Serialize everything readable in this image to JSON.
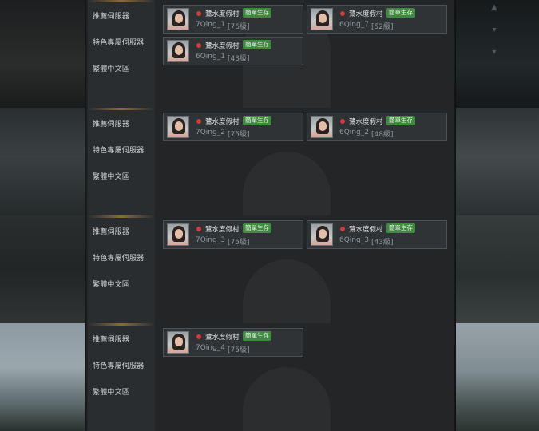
{
  "sidebar": {
    "categories": [
      "推薦伺服器",
      "特色專屬伺服器",
      "繁體中文區"
    ]
  },
  "panels": [
    {
      "cards": [
        {
          "server": "鷺水度假村",
          "badge": "簡單生存",
          "character": "7Qing_1",
          "level": "[76級]"
        },
        {
          "server": "鷺水度假村",
          "badge": "簡單生存",
          "character": "6Qing_7",
          "level": "[52級]"
        },
        {
          "server": "鷺水度假村",
          "badge": "簡單生存",
          "character": "6Qing_1",
          "level": "[43級]"
        }
      ]
    },
    {
      "cards": [
        {
          "server": "鷺水度假村",
          "badge": "簡單生存",
          "character": "7Qing_2",
          "level": "[75級]"
        },
        {
          "server": "鷺水度假村",
          "badge": "簡單生存",
          "character": "6Qing_2",
          "level": "[48級]"
        }
      ]
    },
    {
      "cards": [
        {
          "server": "鷺水度假村",
          "badge": "簡單生存",
          "character": "7Qing_3",
          "level": "[75級]"
        },
        {
          "server": "鷺水度假村",
          "badge": "簡單生存",
          "character": "6Qing_3",
          "level": "[43級]"
        }
      ]
    },
    {
      "cards": [
        {
          "server": "鷺水度假村",
          "badge": "簡單生存",
          "character": "7Qing_4",
          "level": "[75級]"
        }
      ]
    }
  ],
  "icons": {
    "status": "status-dot-icon",
    "avatar": "character-avatar-icon",
    "scroll": "chevron-down-icon"
  },
  "colors": {
    "status_dot": "#d23a3a",
    "badge": "#3f8a3f",
    "accent": "#8a6a3c"
  }
}
